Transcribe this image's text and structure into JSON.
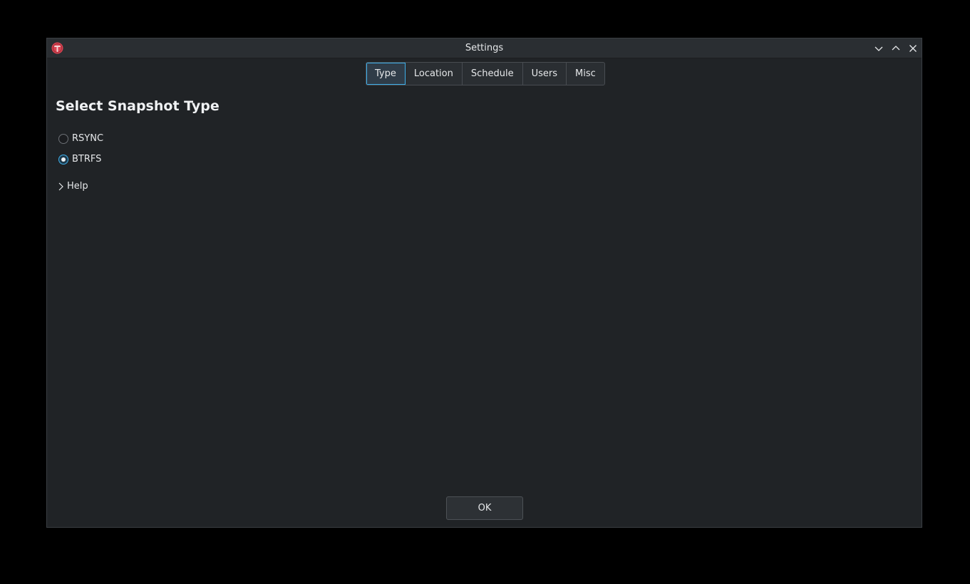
{
  "window": {
    "title": "Settings"
  },
  "tabs": [
    {
      "label": "Type",
      "active": true
    },
    {
      "label": "Location",
      "active": false
    },
    {
      "label": "Schedule",
      "active": false
    },
    {
      "label": "Users",
      "active": false
    },
    {
      "label": "Misc",
      "active": false
    }
  ],
  "section": {
    "title": "Select Snapshot Type"
  },
  "options": [
    {
      "label": "RSYNC",
      "checked": false
    },
    {
      "label": "BTRFS",
      "checked": true
    }
  ],
  "help": {
    "label": "Help",
    "icon": "chevron-right-icon"
  },
  "footer": {
    "ok_label": "OK"
  },
  "colors": {
    "window_bg": "#202326",
    "accent": "#3daee9",
    "app_icon": "#da4453"
  }
}
